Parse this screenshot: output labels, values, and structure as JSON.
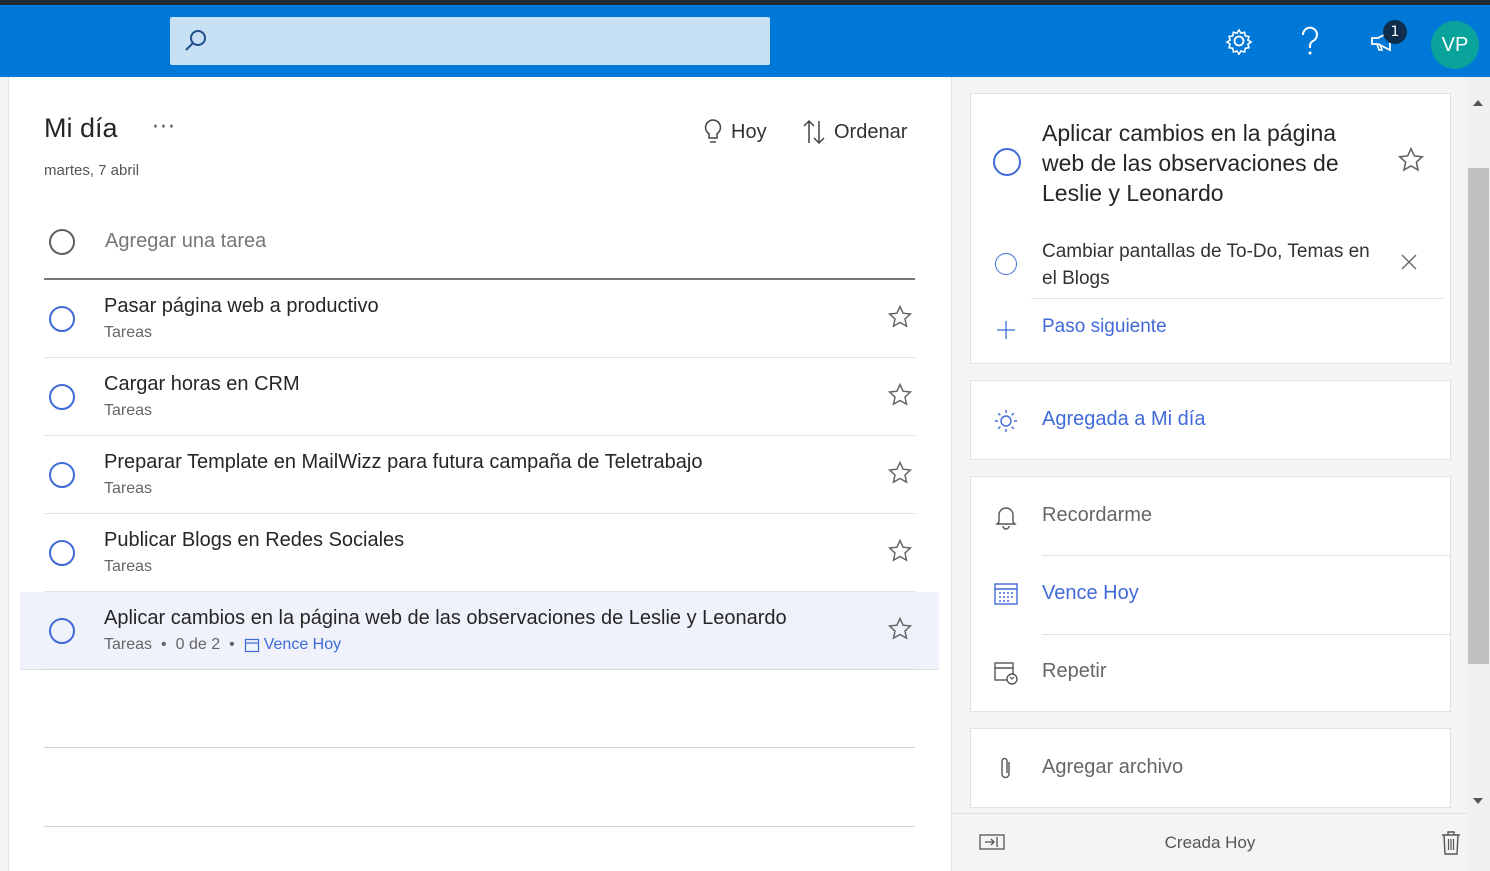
{
  "search": {
    "placeholder": ""
  },
  "header": {
    "notification_count": "1",
    "avatar_initials": "VP"
  },
  "list": {
    "title": "Mi día",
    "more_label": "···",
    "date": "martes, 7 abril",
    "today_button": "Hoy",
    "sort_button": "Ordenar",
    "add_task_placeholder": "Agregar una tarea",
    "tasks": [
      {
        "name": "Pasar página web a productivo",
        "list": "Tareas"
      },
      {
        "name": "Cargar horas en CRM",
        "list": "Tareas"
      },
      {
        "name": "Preparar Template en MailWizz para futura campaña de Teletrabajo",
        "list": "Tareas"
      },
      {
        "name": "Publicar Blogs en Redes Sociales",
        "list": "Tareas"
      },
      {
        "name": "Aplicar cambios en la página web de las observaciones de Leslie y Leonardo",
        "list": "Tareas",
        "steps": "0 de 2",
        "due": "Vence Hoy"
      }
    ]
  },
  "detail": {
    "title": "Aplicar cambios en la página web de las observaciones de Leslie y Leonardo",
    "step": "Cambiar pantallas de To-Do, Temas en el Blogs",
    "next_step": "Paso siguiente",
    "my_day": "Agregada a Mi día",
    "remind": "Recordarme",
    "due": "Vence Hoy",
    "repeat": "Repetir",
    "attach": "Agregar archivo",
    "created": "Creada Hoy"
  },
  "colors": {
    "header": "#0078d7",
    "accent": "#3f6ad8",
    "avatar": "#0aa39c"
  },
  "icons": [
    "search-icon",
    "gear-icon",
    "help-icon",
    "megaphone-icon",
    "bulb-icon",
    "sort-icon",
    "star-icon",
    "calendar-icon",
    "sun-icon",
    "bell-icon",
    "repeat-icon",
    "paperclip-icon",
    "hide-panel-icon",
    "trash-icon"
  ]
}
